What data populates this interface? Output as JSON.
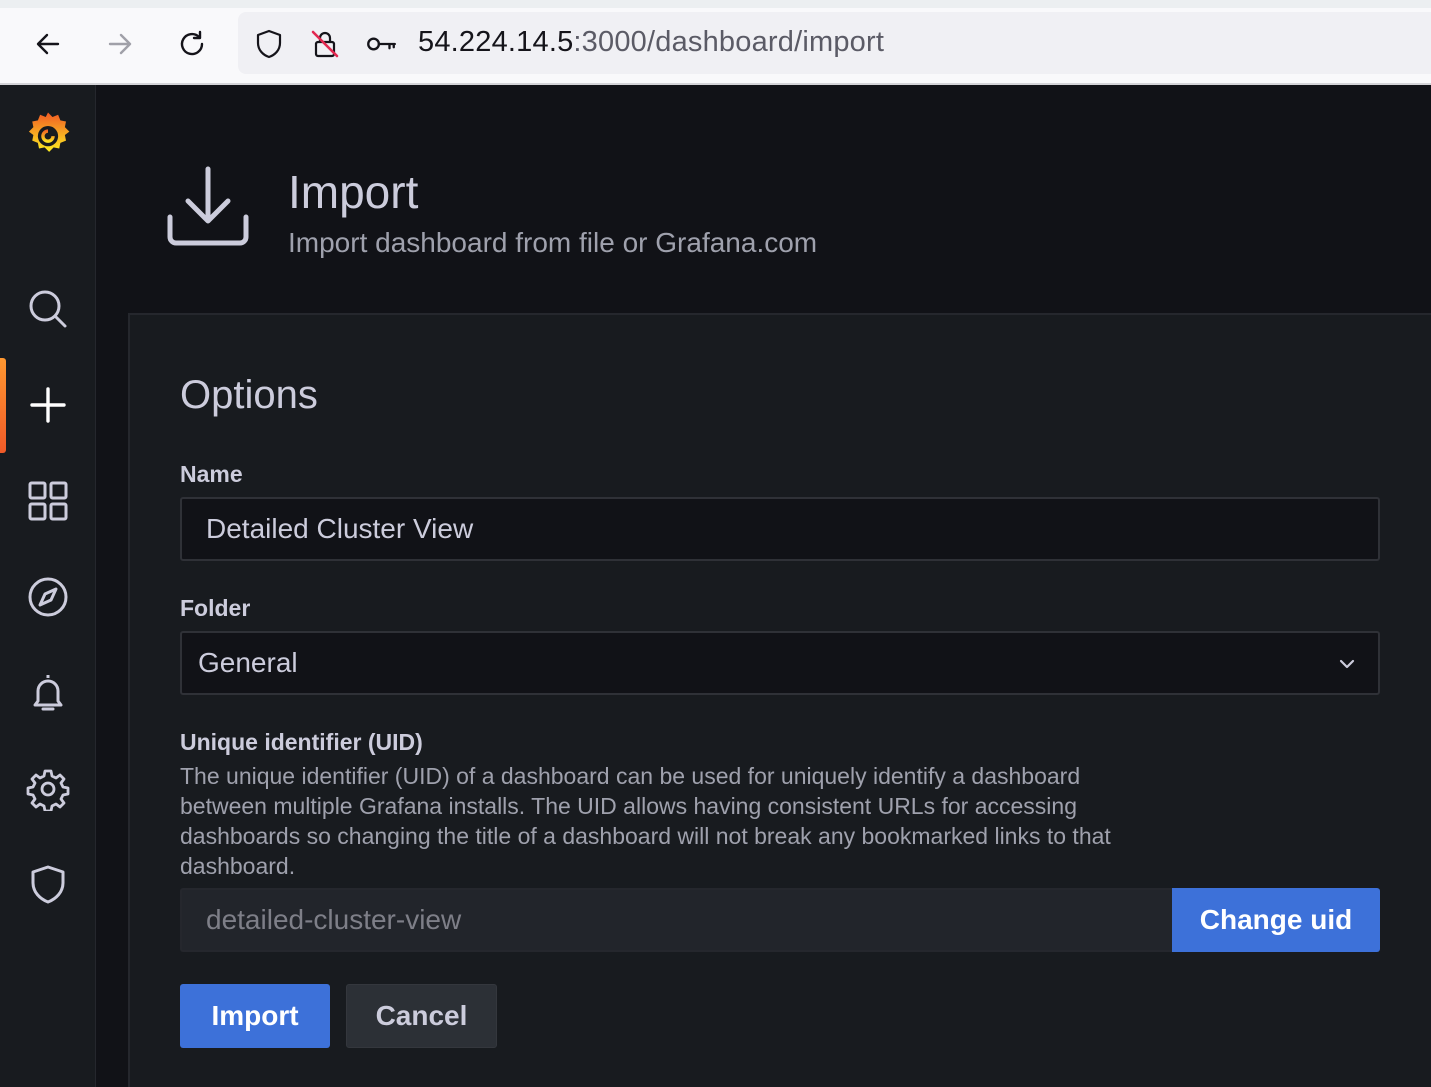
{
  "browser": {
    "url_host": "54.224.14.5",
    "url_rest": ":3000/dashboard/import"
  },
  "sidebar": {
    "items": [
      {
        "name": "grafana-logo",
        "icon": "grafana-logo"
      },
      {
        "name": "search",
        "icon": "search-icon"
      },
      {
        "name": "create",
        "icon": "plus-icon",
        "active": true
      },
      {
        "name": "dashboards",
        "icon": "apps-icon"
      },
      {
        "name": "explore",
        "icon": "compass-icon"
      },
      {
        "name": "alerting",
        "icon": "bell-icon"
      },
      {
        "name": "configuration",
        "icon": "gear-icon"
      },
      {
        "name": "server-admin",
        "icon": "shield-icon"
      }
    ],
    "active_color": "#f05a28"
  },
  "header": {
    "title": "Import",
    "subtitle": "Import dashboard from file or Grafana.com"
  },
  "options": {
    "title": "Options",
    "name_label": "Name",
    "name_value": "Detailed Cluster View",
    "folder_label": "Folder",
    "folder_value": "General",
    "uid_label": "Unique identifier (UID)",
    "uid_description": "The unique identifier (UID) of a dashboard can be used for uniquely identify a dashboard between multiple Grafana installs. The UID allows having consistent URLs for accessing dashboards so changing the title of a dashboard will not break any bookmarked links to that dashboard.",
    "uid_value": "detailed-cluster-view",
    "change_uid_label": "Change uid"
  },
  "actions": {
    "import_label": "Import",
    "cancel_label": "Cancel"
  },
  "colors": {
    "primary": "#3d71d9",
    "background": "#111217",
    "panel": "#181b1f"
  }
}
